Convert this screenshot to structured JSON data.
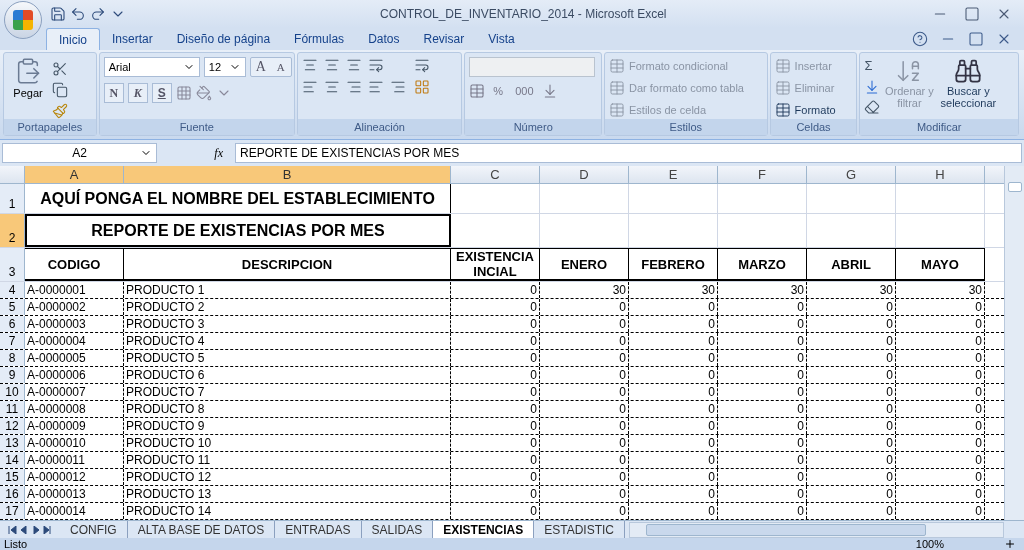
{
  "window": {
    "title": "CONTROL_DE_INVENTARIO_2014 - Microsoft Excel"
  },
  "ribbon_tabs": [
    {
      "label": "Inicio",
      "selected": true
    },
    {
      "label": "Insertar",
      "selected": false
    },
    {
      "label": "Diseño de página",
      "selected": false
    },
    {
      "label": "Fórmulas",
      "selected": false
    },
    {
      "label": "Datos",
      "selected": false
    },
    {
      "label": "Revisar",
      "selected": false
    },
    {
      "label": "Vista",
      "selected": false
    }
  ],
  "clipboard": {
    "paste": "Pegar",
    "group": "Portapapeles"
  },
  "font": {
    "name": "Arial",
    "size": "12",
    "bold": "N",
    "italic": "K",
    "underline": "S",
    "grow": "A",
    "shrink": "A",
    "group": "Fuente"
  },
  "alignment": {
    "group": "Alineación"
  },
  "number": {
    "percent": "%",
    "thousands": "000",
    "group": "Número"
  },
  "styles": {
    "items": [
      {
        "label": "Formato condicional",
        "disabled": true
      },
      {
        "label": "Dar formato como tabla",
        "disabled": true
      },
      {
        "label": "Estilos de celda",
        "disabled": true
      }
    ],
    "group": "Estilos"
  },
  "cells": {
    "items": [
      {
        "label": "Insertar",
        "disabled": true
      },
      {
        "label": "Eliminar",
        "disabled": true
      },
      {
        "label": "Formato",
        "disabled": false
      }
    ],
    "group": "Celdas"
  },
  "editing": {
    "sum": "Σ",
    "sort": {
      "label": "Ordenar y filtrar",
      "disabled": true
    },
    "find": {
      "label": "Buscar y seleccionar",
      "disabled": false
    },
    "group": "Modificar"
  },
  "formula_bar": {
    "name_box": "A2",
    "fx": "fx",
    "value": "REPORTE DE EXISTENCIAS POR MES"
  },
  "columns": [
    {
      "label": "A",
      "selected": true
    },
    {
      "label": "B",
      "selected": true
    },
    {
      "label": "C",
      "selected": false
    },
    {
      "label": "D",
      "selected": false
    },
    {
      "label": "E",
      "selected": false
    },
    {
      "label": "F",
      "selected": false
    },
    {
      "label": "G",
      "selected": false
    },
    {
      "label": "H",
      "selected": false
    }
  ],
  "row_numbers": [
    {
      "label": "1",
      "selected": false
    },
    {
      "label": "2",
      "selected": true
    },
    {
      "label": "3",
      "selected": false
    },
    {
      "label": "4",
      "selected": false
    },
    {
      "label": "5",
      "selected": false
    },
    {
      "label": "6",
      "selected": false
    },
    {
      "label": "7",
      "selected": false
    },
    {
      "label": "8",
      "selected": false
    },
    {
      "label": "9",
      "selected": false
    },
    {
      "label": "10",
      "selected": false
    },
    {
      "label": "11",
      "selected": false
    },
    {
      "label": "12",
      "selected": false
    },
    {
      "label": "13",
      "selected": false
    },
    {
      "label": "14",
      "selected": false
    },
    {
      "label": "15",
      "selected": false
    },
    {
      "label": "16",
      "selected": false
    },
    {
      "label": "17",
      "selected": false
    }
  ],
  "sheet": {
    "establishment": "AQUÍ PONGA EL NOMBRE DEL ESTABLECIMIENTO",
    "report_title": "REPORTE DE EXISTENCIAS POR MES",
    "headers": [
      "CODIGO",
      "DESCRIPCION",
      "EXISTENCIA INCIAL",
      "ENERO",
      "FEBRERO",
      "MARZO",
      "ABRIL",
      "MAYO"
    ],
    "rows": [
      [
        "A-0000001",
        "PRODUCTO 1",
        "0",
        "30",
        "30",
        "30",
        "30",
        "30"
      ],
      [
        "A-0000002",
        "PRODUCTO 2",
        "0",
        "0",
        "0",
        "0",
        "0",
        "0"
      ],
      [
        "A-0000003",
        "PRODUCTO 3",
        "0",
        "0",
        "0",
        "0",
        "0",
        "0"
      ],
      [
        "A-0000004",
        "PRODUCTO 4",
        "0",
        "0",
        "0",
        "0",
        "0",
        "0"
      ],
      [
        "A-0000005",
        "PRODUCTO 5",
        "0",
        "0",
        "0",
        "0",
        "0",
        "0"
      ],
      [
        "A-0000006",
        "PRODUCTO 6",
        "0",
        "0",
        "0",
        "0",
        "0",
        "0"
      ],
      [
        "A-0000007",
        "PRODUCTO 7",
        "0",
        "0",
        "0",
        "0",
        "0",
        "0"
      ],
      [
        "A-0000008",
        "PRODUCTO 8",
        "0",
        "0",
        "0",
        "0",
        "0",
        "0"
      ],
      [
        "A-0000009",
        "PRODUCTO 9",
        "0",
        "0",
        "0",
        "0",
        "0",
        "0"
      ],
      [
        "A-0000010",
        "PRODUCTO 10",
        "0",
        "0",
        "0",
        "0",
        "0",
        "0"
      ],
      [
        "A-0000011",
        "PRODUCTO 11",
        "0",
        "0",
        "0",
        "0",
        "0",
        "0"
      ],
      [
        "A-0000012",
        "PRODUCTO 12",
        "0",
        "0",
        "0",
        "0",
        "0",
        "0"
      ],
      [
        "A-0000013",
        "PRODUCTO 13",
        "0",
        "0",
        "0",
        "0",
        "0",
        "0"
      ],
      [
        "A-0000014",
        "PRODUCTO 14",
        "0",
        "0",
        "0",
        "0",
        "0",
        "0"
      ]
    ]
  },
  "sheet_tabs": [
    {
      "label": "CONFIG",
      "selected": false
    },
    {
      "label": "ALTA BASE DE DATOS",
      "selected": false
    },
    {
      "label": "ENTRADAS",
      "selected": false
    },
    {
      "label": "SALIDAS",
      "selected": false
    },
    {
      "label": "EXISTENCIAS",
      "selected": true
    },
    {
      "label": "ESTADISTIC",
      "selected": false
    }
  ],
  "status_bar": {
    "status": "Listo",
    "zoom": "100%"
  }
}
